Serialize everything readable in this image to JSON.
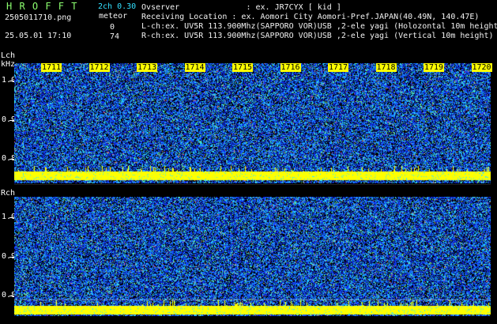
{
  "header": {
    "app_name": "H R O F F T",
    "version": "2ch 0.30",
    "meteor_label": "meteor",
    "filename": "2505011710.png",
    "datetime": "25.05.01 17:10",
    "lch_count": "0",
    "rch_count": "74",
    "observer_line": "Ovserver              : ex. JR7CYX [ kid ]",
    "location_line": "Receiving Location : ex. Aomori City Aomori-Pref.JAPAN(40.49N, 140.47E)",
    "lch_line": "L-ch:ex. UV5R 113.900Mhz(SAPPORO VOR)USB ,2-ele yagi (Holozontal 10m height)",
    "rch_line": "R-ch:ex. UV5R 113.900Mhz(SAPPORO VOR)USB ,2-ele yagi (Vertical 10m height)"
  },
  "time_labels": [
    "1711",
    "1712",
    "1713",
    "1714",
    "1715",
    "1716",
    "1717",
    "1718",
    "1719",
    "1720"
  ],
  "lch": {
    "label": "Lch",
    "unit": "kHz",
    "ticks": [
      "1.0",
      "0.9",
      "0.8"
    ]
  },
  "rch": {
    "label": "Rch",
    "ticks": [
      "1.0",
      "0.9",
      "0.8"
    ]
  },
  "colors": {
    "noise_blue": "#1a3cff",
    "noise_cyan": "#33e0ff",
    "carrier_yellow": "#ffff00",
    "header_cyan": "#33e0ff",
    "header_green": "#8cff70"
  }
}
